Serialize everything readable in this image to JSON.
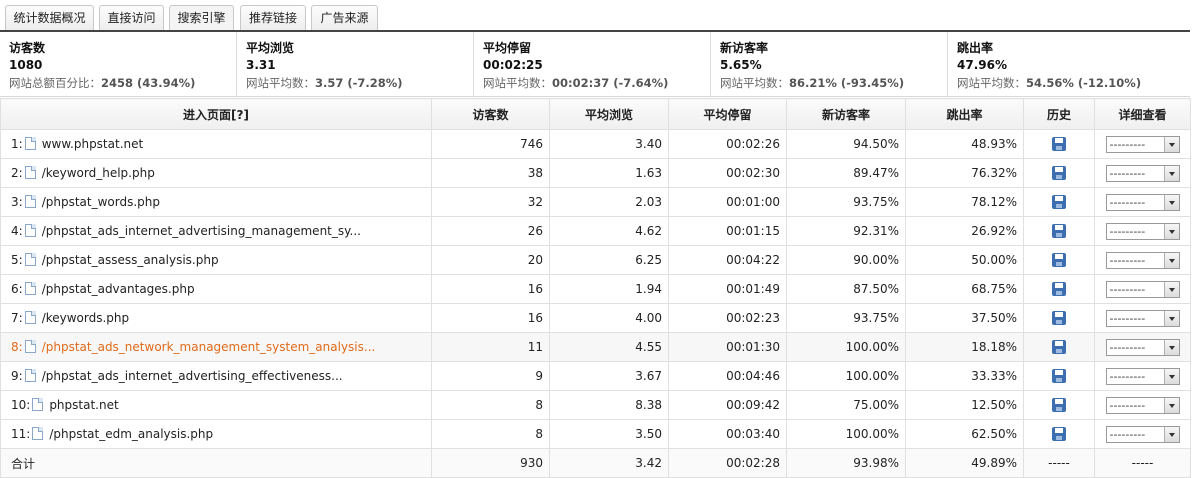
{
  "tabs": [
    "统计数据概况",
    "直接访问",
    "搜索引擎",
    "推荐链接",
    "广告来源"
  ],
  "active_tab": 2,
  "summary": [
    {
      "title": "访客数",
      "value": "1080",
      "foot_label": "网站总额百分比：",
      "foot_value": "2458 (43.94%)"
    },
    {
      "title": "平均浏览",
      "value": "3.31",
      "foot_label": "网站平均数：",
      "foot_value": "3.57 (-7.28%)"
    },
    {
      "title": "平均停留",
      "value": "00:02:25",
      "foot_label": "网站平均数：",
      "foot_value": "00:02:37 (-7.64%)"
    },
    {
      "title": "新访客率",
      "value": "5.65%",
      "foot_label": "网站平均数：",
      "foot_value": "86.21% (-93.45%)"
    },
    {
      "title": "跳出率",
      "value": "47.96%",
      "foot_label": "网站平均数：",
      "foot_value": "54.56% (-12.10%)"
    }
  ],
  "table": {
    "headers": [
      "进入页面[?]",
      "访客数",
      "平均浏览",
      "平均停留",
      "新访客率",
      "跳出率",
      "历史",
      "详细查看"
    ],
    "rows": [
      {
        "idx": "1:",
        "page": "www.phpstat.net",
        "visitors": "746",
        "views": "3.40",
        "stay": "00:02:26",
        "new": "94.50%",
        "bounce": "48.93%"
      },
      {
        "idx": "2:",
        "page": "/keyword_help.php",
        "visitors": "38",
        "views": "1.63",
        "stay": "00:02:30",
        "new": "89.47%",
        "bounce": "76.32%"
      },
      {
        "idx": "3:",
        "page": "/phpstat_words.php",
        "visitors": "32",
        "views": "2.03",
        "stay": "00:01:00",
        "new": "93.75%",
        "bounce": "78.12%"
      },
      {
        "idx": "4:",
        "page": "/phpstat_ads_internet_advertising_management_sy...",
        "visitors": "26",
        "views": "4.62",
        "stay": "00:01:15",
        "new": "92.31%",
        "bounce": "26.92%"
      },
      {
        "idx": "5:",
        "page": "/phpstat_assess_analysis.php",
        "visitors": "20",
        "views": "6.25",
        "stay": "00:04:22",
        "new": "90.00%",
        "bounce": "50.00%"
      },
      {
        "idx": "6:",
        "page": "/phpstat_advantages.php",
        "visitors": "16",
        "views": "1.94",
        "stay": "00:01:49",
        "new": "87.50%",
        "bounce": "68.75%"
      },
      {
        "idx": "7:",
        "page": "/keywords.php",
        "visitors": "16",
        "views": "4.00",
        "stay": "00:02:23",
        "new": "93.75%",
        "bounce": "37.50%"
      },
      {
        "idx": "8:",
        "page": "/phpstat_ads_network_management_system_analysis...",
        "visitors": "11",
        "views": "4.55",
        "stay": "00:01:30",
        "new": "100.00%",
        "bounce": "18.18%"
      },
      {
        "idx": "9:",
        "page": "/phpstat_ads_internet_advertising_effectiveness...",
        "visitors": "9",
        "views": "3.67",
        "stay": "00:04:46",
        "new": "100.00%",
        "bounce": "33.33%"
      },
      {
        "idx": "10:",
        "page": "phpstat.net",
        "visitors": "8",
        "views": "8.38",
        "stay": "00:09:42",
        "new": "75.00%",
        "bounce": "12.50%"
      },
      {
        "idx": "11:",
        "page": "/phpstat_edm_analysis.php",
        "visitors": "8",
        "views": "3.50",
        "stay": "00:03:40",
        "new": "100.00%",
        "bounce": "62.50%"
      }
    ],
    "highlight_row": 7,
    "select_placeholder": "---------",
    "total": {
      "label": "合计",
      "visitors": "930",
      "views": "3.42",
      "stay": "00:02:28",
      "new": "93.98%",
      "bounce": "49.89%",
      "history": "-----",
      "detail": "-----"
    }
  },
  "colors": {
    "highlight_text": "#e06b1a",
    "tab_underline": "#444444"
  },
  "icons": {
    "page": "page-icon",
    "history": "save-icon",
    "detail": "dropdown-arrow-icon"
  }
}
